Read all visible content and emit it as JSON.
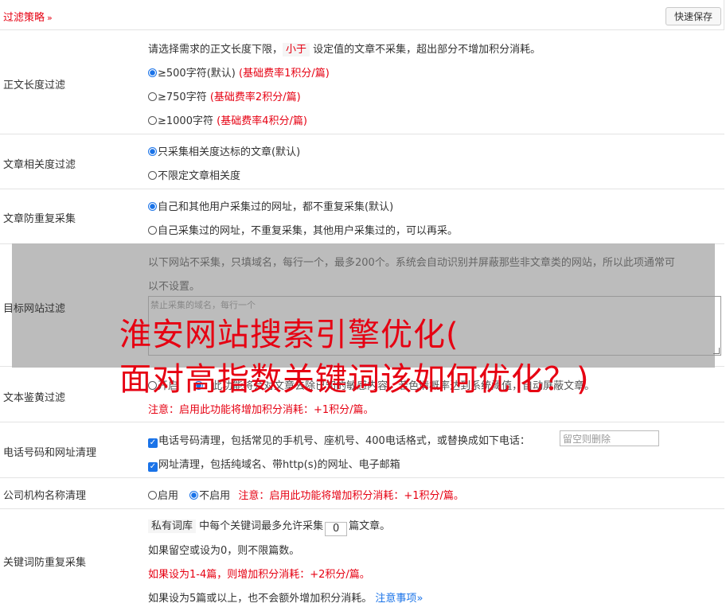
{
  "header": {
    "title": "过滤策略",
    "chevron": "»",
    "save_button": "快速保存"
  },
  "length_filter": {
    "label": "正文长度过滤",
    "desc_pre": "请选择需求的正文长度下限，",
    "desc_tag": "小于",
    "desc_post": "设定值的文章不采集，超出部分不增加积分消耗。",
    "options": [
      {
        "text": "≥500字符(默认)",
        "note": "(基础费率1积分/篇)",
        "checked": true
      },
      {
        "text": "≥750字符",
        "note": "(基础费率2积分/篇)",
        "checked": false
      },
      {
        "text": "≥1000字符",
        "note": "(基础费率4积分/篇)",
        "checked": false
      }
    ]
  },
  "relevance_filter": {
    "label": "文章相关度过滤",
    "options": [
      {
        "text": "只采集相关度达标的文章(默认)",
        "checked": true
      },
      {
        "text": "不限定文章相关度",
        "checked": false
      }
    ]
  },
  "dedupe_filter": {
    "label": "文章防重复采集",
    "options": [
      {
        "text": "自己和其他用户采集过的网址，都不重复采集(默认)",
        "checked": true
      },
      {
        "text": "自己采集过的网址，不重复采集，其他用户采集过的，可以再采。",
        "checked": false
      }
    ]
  },
  "site_filter": {
    "label": "目标网站过滤",
    "desc_line1": "以下网站不采集，只填域名，每行一个，最多200个。系统会自动识别并屏蔽那些非文章类的网站，所以此项通常可",
    "desc_line2": "以不设置。",
    "placeholder": "禁止采集的域名，每行一个"
  },
  "text_check": {
    "label": "文本鉴黄过滤",
    "option_on": "开启",
    "visible_fragment": "此功能将会对文章去除已知的敏感内容，若色情概率达到系统阈值，自动屏蔽文章。",
    "note": "注意：启用此功能将增加积分消耗：+1积分/篇。"
  },
  "phone_url": {
    "label": "电话号码和网址清理",
    "phone_text": "电话号码清理，包括常见的手机号、座机号、400电话格式，或替换成如下电话：",
    "phone_placeholder": "留空则删除",
    "url_text": "网址清理，包括纯域名、带http(s)的网址、电子邮箱"
  },
  "org_name": {
    "label": "公司机构名称清理",
    "opt_on": "启用",
    "opt_off": "不启用",
    "note": "注意：启用此功能将增加积分消耗：+1积分/篇。"
  },
  "keyword_dedupe": {
    "label": "关键词防重复采集",
    "tag": "私有词库",
    "line1_mid": "中每个关键词最多允许采集",
    "value": "0",
    "line1_post": "篇文章。",
    "line2": "如果留空或设为0，则不限篇数。",
    "line3": "如果设为1-4篇，则增加积分消耗：+2积分/篇。",
    "line4": "如果设为5篇或以上，也不会额外增加积分消耗。",
    "link": "注意事项",
    "link_chevron": "»"
  },
  "overlay": {
    "line1": "淮安网站搜索引擎优化(",
    "line2": "面对高指数关键词该如何优化？)"
  }
}
